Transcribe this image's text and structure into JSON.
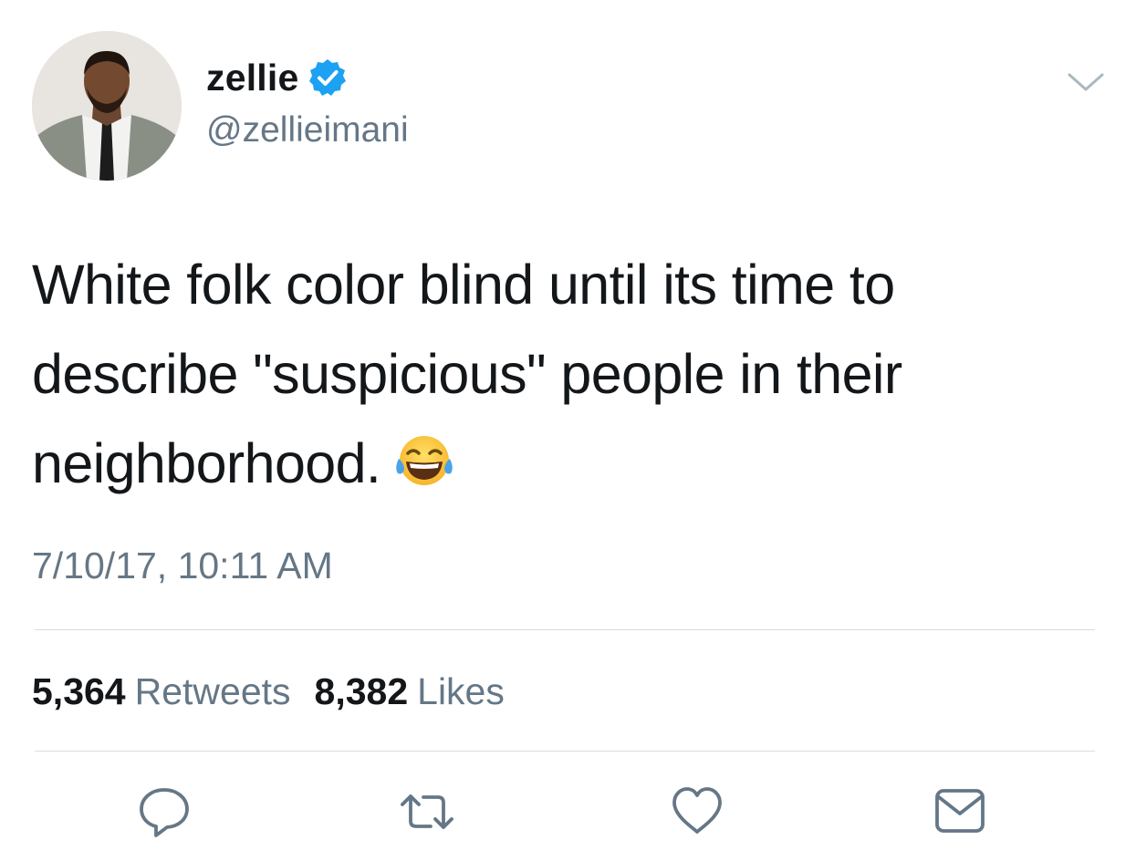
{
  "user": {
    "display_name": "zellie",
    "handle": "@zellieimani",
    "verified": true,
    "avatar_icon": "profile-photo"
  },
  "tweet": {
    "text": "White folk color blind until its time to describe \"suspicious\" people in their neighborhood.",
    "emoji": "face-with-tears-of-joy",
    "timestamp": "7/10/17, 10:11 AM"
  },
  "stats": {
    "retweets_count": "5,364",
    "retweets_label": "Retweets",
    "likes_count": "8,382",
    "likes_label": "Likes"
  },
  "actions": {
    "reply_icon": "reply-icon",
    "retweet_icon": "retweet-icon",
    "like_icon": "heart-icon",
    "message_icon": "envelope-icon"
  },
  "colors": {
    "text_primary": "#14171a",
    "text_secondary": "#657786",
    "verified_blue": "#1da1f2",
    "divider": "#d8dde1",
    "icon_gray": "#657786"
  }
}
